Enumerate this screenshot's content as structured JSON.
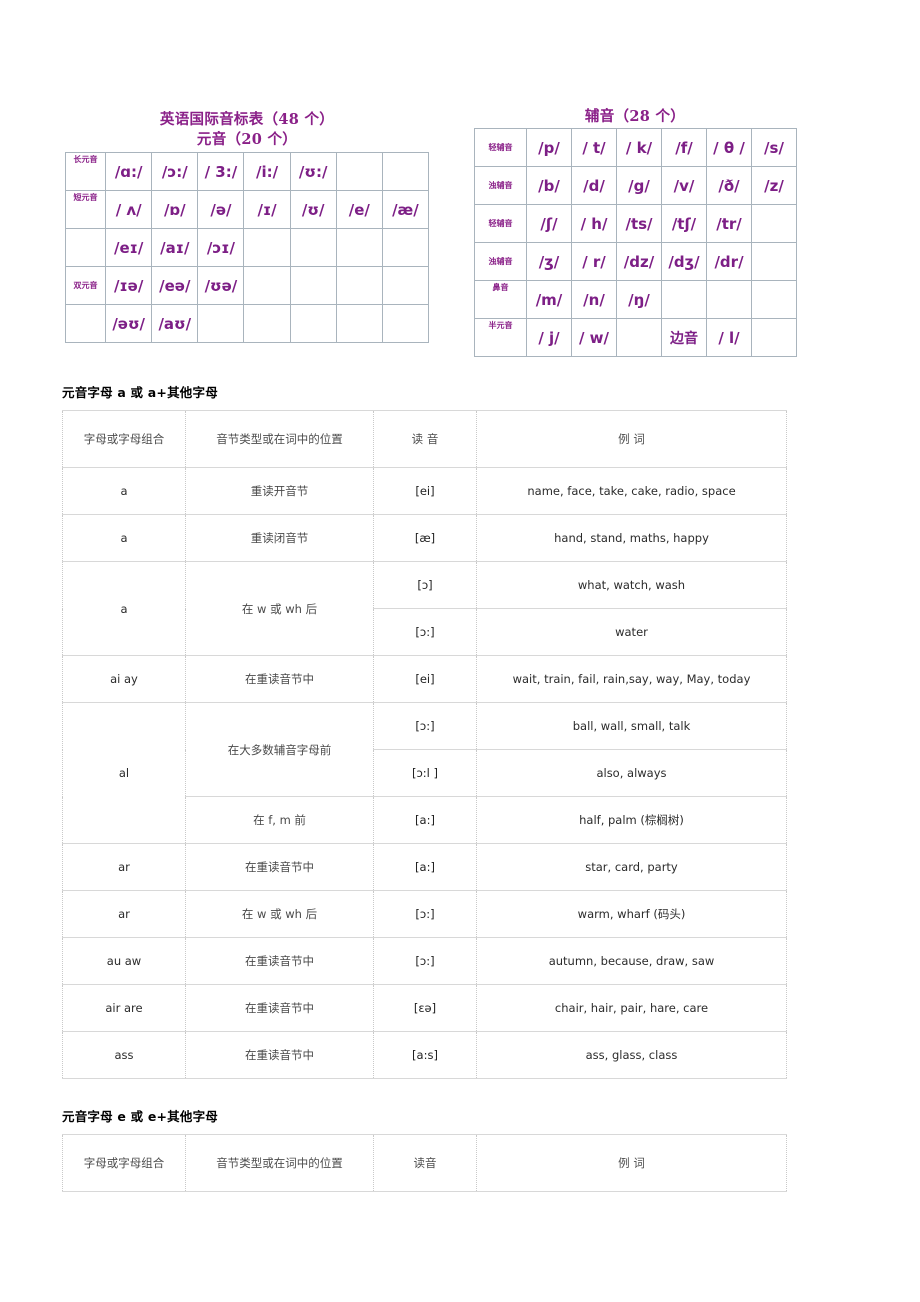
{
  "ipa_chart": {
    "vowels": {
      "title_line1": "英语国际音标表（48 个）",
      "title_line2": "元音（20 个）",
      "row_labels": [
        "长元音",
        "短元音",
        "",
        "双元音",
        ""
      ],
      "rows": [
        [
          "/ɑ:/",
          "/ɔ:/",
          "/ 3:/",
          "/i:/",
          "/ʊ:/",
          "",
          ""
        ],
        [
          "/ ʌ/",
          "/ɒ/",
          "/ə/",
          "/ɪ/",
          "/ʊ/",
          "/e/",
          "/æ/"
        ],
        [
          "/eɪ/",
          "/aɪ/",
          "/ɔɪ/",
          "",
          "",
          "",
          ""
        ],
        [
          "/ɪə/",
          "/eə/",
          "/ʊə/",
          "",
          "",
          "",
          ""
        ],
        [
          "/əʊ/",
          "/aʊ/",
          "",
          "",
          "",
          "",
          ""
        ]
      ]
    },
    "consonants": {
      "title": "辅音（28 个）",
      "row_labels": [
        "轻辅音",
        "浊辅音",
        "轻辅音",
        "浊辅音",
        "鼻音",
        "半元音"
      ],
      "rows": [
        [
          "/p/",
          "/ t/",
          "/ k/",
          "/f/",
          "/ θ /",
          "/s/"
        ],
        [
          "/b/",
          "/d/",
          "/g/",
          "/v/",
          "/ð/",
          "/z/"
        ],
        [
          "/ʃ/",
          "/ h/",
          "/ts/",
          "/tʃ/",
          "/tr/",
          ""
        ],
        [
          "/ʒ/",
          "/ r/",
          "/dz/",
          "/dʒ/",
          "/dr/",
          ""
        ],
        [
          "/m/",
          "/n/",
          "/ŋ/",
          "",
          "",
          ""
        ],
        [
          "/ j/",
          "/ w/",
          "",
          "边音",
          "/ l/",
          ""
        ]
      ],
      "lateral_label": "边音"
    },
    "colors": {
      "symbol_purple": "#7d1f86",
      "title_purple": "#8a2088",
      "grid_gray": "#a9b4bd"
    }
  },
  "section_a": {
    "heading": "元音字母 a 或 a+其他字母",
    "headers": [
      "字母或字母组合",
      "音节类型或在词中的位置",
      "读 音",
      "例 词"
    ],
    "rows": [
      {
        "letters": "a",
        "position": "重读开音节",
        "sound": "[ei]",
        "words": "name, face, take, cake, radio, space"
      },
      {
        "letters": "a",
        "position": "重读闭音节",
        "sound": "[æ]",
        "words": "hand, stand, maths, happy"
      },
      {
        "letters": "a",
        "position": "在 w 或 wh 后",
        "sound": "[ɔ]",
        "words": "what, watch, wash"
      },
      {
        "letters": "",
        "position": "",
        "sound": "[ɔ:]",
        "words": "water"
      },
      {
        "letters": "ai ay",
        "position": "在重读音节中",
        "sound": "[ei]",
        "words": "wait, train, fail, rain,say, way, May, today"
      },
      {
        "letters": "al",
        "position": "在大多数辅音字母前",
        "sound": "[ɔ:]",
        "words": "ball, wall, small, talk"
      },
      {
        "letters": "",
        "position": "",
        "sound": "[ɔ:l ]",
        "words": "also, always"
      },
      {
        "letters": "",
        "position": "在 f, m 前",
        "sound": "[a:]",
        "words": "half, palm (棕榈树)"
      },
      {
        "letters": "ar",
        "position": "在重读音节中",
        "sound": "[a:]",
        "words": "star, card, party"
      },
      {
        "letters": "ar",
        "position": "在 w 或 wh 后",
        "sound": "[ɔ:]",
        "words": "warm, wharf (码头)"
      },
      {
        "letters": "au aw",
        "position": "在重读音节中",
        "sound": "[ɔ:]",
        "words": "autumn, because, draw, saw"
      },
      {
        "letters": "air are",
        "position": "在重读音节中",
        "sound": "[ɛə]",
        "words": "chair, hair, pair, hare, care"
      },
      {
        "letters": "ass",
        "position": "在重读音节中",
        "sound": "[a:s]",
        "words": "ass, glass, class"
      }
    ]
  },
  "section_e": {
    "heading": "元音字母 e 或 e+其他字母",
    "headers": [
      "字母或字母组合",
      "音节类型或在词中的位置",
      "读音",
      "例 词"
    ]
  }
}
